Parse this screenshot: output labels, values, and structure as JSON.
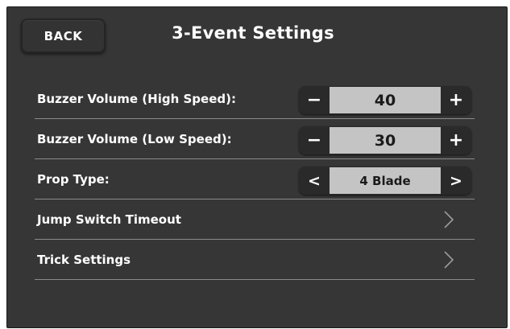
{
  "header": {
    "back_label": "BACK",
    "title": "3-Event Settings"
  },
  "settings": {
    "buzzer_high": {
      "label": "Buzzer Volume (High Speed):",
      "value": "40",
      "dec_glyph": "−",
      "inc_glyph": "+"
    },
    "buzzer_low": {
      "label": "Buzzer Volume (Low Speed):",
      "value": "30",
      "dec_glyph": "−",
      "inc_glyph": "+"
    },
    "prop_type": {
      "label": "Prop Type:",
      "value": "4 Blade",
      "prev_glyph": "<",
      "next_glyph": ">"
    },
    "jump_switch_timeout": {
      "label": "Jump Switch Timeout",
      "icon": "chevron-right-icon"
    },
    "trick_settings": {
      "label": "Trick Settings",
      "icon": "chevron-right-icon"
    }
  },
  "colors": {
    "background": "#363636",
    "stepper_value_bg": "#c4c4c4",
    "divider": "#8a8a8a",
    "chevron": "#9a9a9a"
  }
}
